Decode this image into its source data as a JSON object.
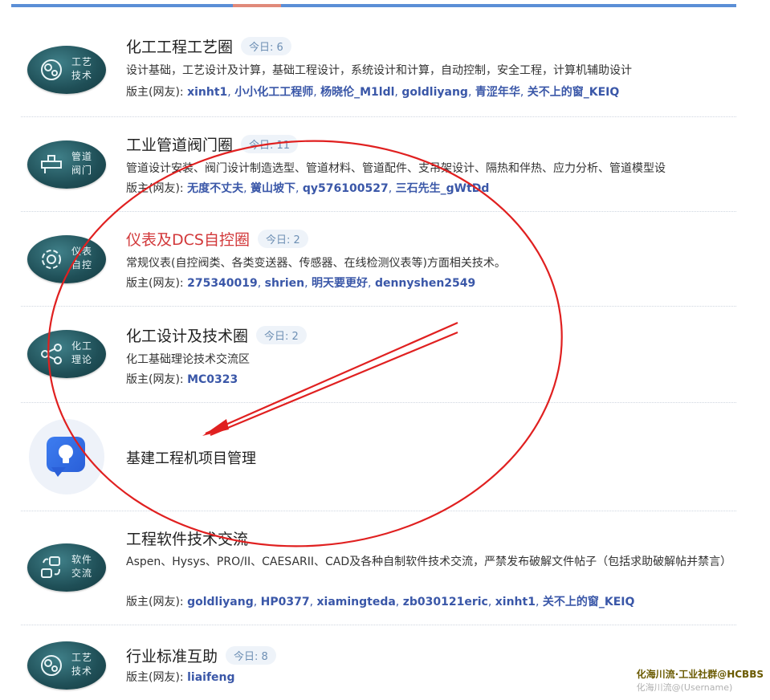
{
  "forums": [
    {
      "badge_lines": [
        "工艺",
        "技术"
      ],
      "title": "化工工程工艺圈",
      "today": "今日: 6",
      "desc": "设计基础，工艺设计及计算，基础工程设计，系统设计和计算，自动控制，安全工程，计算机辅助设计",
      "mods_label": "版主(网友):",
      "mods": [
        "xinht1",
        "小小化工工程师",
        "杨晓伦_M1ldl",
        "goldliyang",
        "青涩年华",
        "关不上的窗_KEIQ"
      ]
    },
    {
      "badge_lines": [
        "管道",
        "阀门"
      ],
      "title": "工业管道阀门圈",
      "today": "今日: 11",
      "desc": "管道设计安装、阀门设计制造选型、管道材料、管道配件、支吊架设计、隔热和伴热、应力分析、管道模型设",
      "mods_label": "版主(网友):",
      "mods": [
        "无度不丈夫",
        "黉山坡下",
        "qy576100527",
        "三石先生_gWtDd"
      ]
    },
    {
      "badge_lines": [
        "仪表",
        "自控"
      ],
      "title": "仪表及DCS自控圈",
      "today": "今日: 2",
      "desc": "常规仪表(自控阀类、各类变送器、传感器、在线检测仪表等)方面相关技术。",
      "mods_label": "版主(网友):",
      "mods": [
        "275340019",
        "shrien",
        "明天要更好",
        "dennyshen2549"
      ]
    },
    {
      "badge_lines": [
        "化工",
        "理论"
      ],
      "title": "化工设计及技术圈",
      "today": "今日: 2",
      "desc": "化工基础理论技术交流区",
      "mods_label": "版主(网友):",
      "mods": [
        "MC0323"
      ]
    },
    {
      "title": "基建工程机项目管理"
    },
    {
      "badge_lines": [
        "软件",
        "交流"
      ],
      "title": "工程软件技术交流",
      "desc": "Aspen、Hysys、PRO/II、CAESARII、CAD及各种自制软件技术交流，严禁发布破解文件帖子（包括求助破解帖并禁言）",
      "mods_label": "版主(网友):",
      "mods": [
        "goldliyang",
        "HP0377",
        "xiamingteda",
        "zb030121eric",
        "xinht1",
        "关不上的窗_KEIQ"
      ]
    },
    {
      "badge_lines": [
        "工艺",
        "技术"
      ],
      "title": "行业标准互助",
      "today": "今日: 8",
      "mods_label": "版主(网友):",
      "mods": [
        "liaifeng"
      ]
    }
  ],
  "watermark": {
    "line1": "化海川流·工业社群@HCBBS",
    "line2": "化海川流@(Username)"
  },
  "colors": {
    "accent_blue": "#5b8fd6",
    "moderator_blue": "#3a57a8",
    "highlight_red": "#d2383a",
    "annotation_red": "#e02020"
  }
}
